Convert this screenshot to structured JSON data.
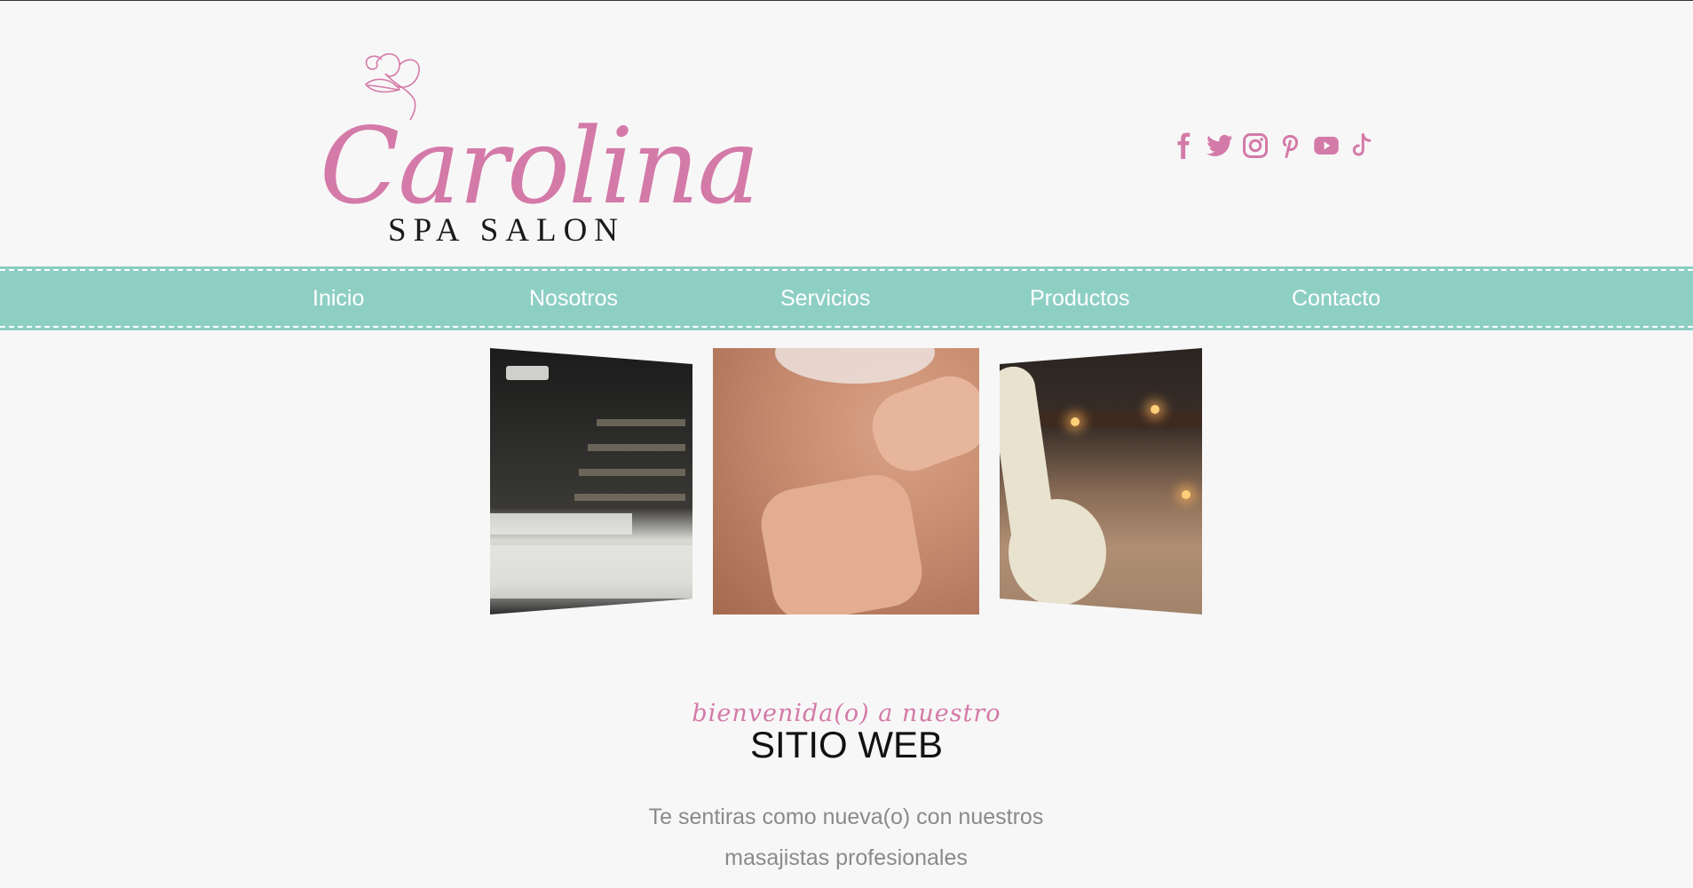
{
  "brand": {
    "name": "Carolina",
    "subtitle": "SPA SALON",
    "color": "#d47aa8"
  },
  "social": {
    "icons": [
      "facebook-icon",
      "twitter-icon",
      "instagram-icon",
      "pinterest-icon",
      "youtube-icon",
      "tiktok-icon"
    ]
  },
  "nav": {
    "background": "#8ecfc4",
    "items": [
      {
        "label": "Inicio"
      },
      {
        "label": "Nosotros"
      },
      {
        "label": "Servicios"
      },
      {
        "label": "Productos"
      },
      {
        "label": "Contacto"
      }
    ]
  },
  "gallery": {
    "images": [
      "spa-room-photo",
      "massage-photo",
      "towel-swan-photo"
    ]
  },
  "intro": {
    "welcome": "bienvenida(o) a nuestro",
    "title": "SITIO WEB",
    "description_line1": "Te sentiras como nueva(o) con nuestros",
    "description_line2": "masajistas profesionales"
  }
}
